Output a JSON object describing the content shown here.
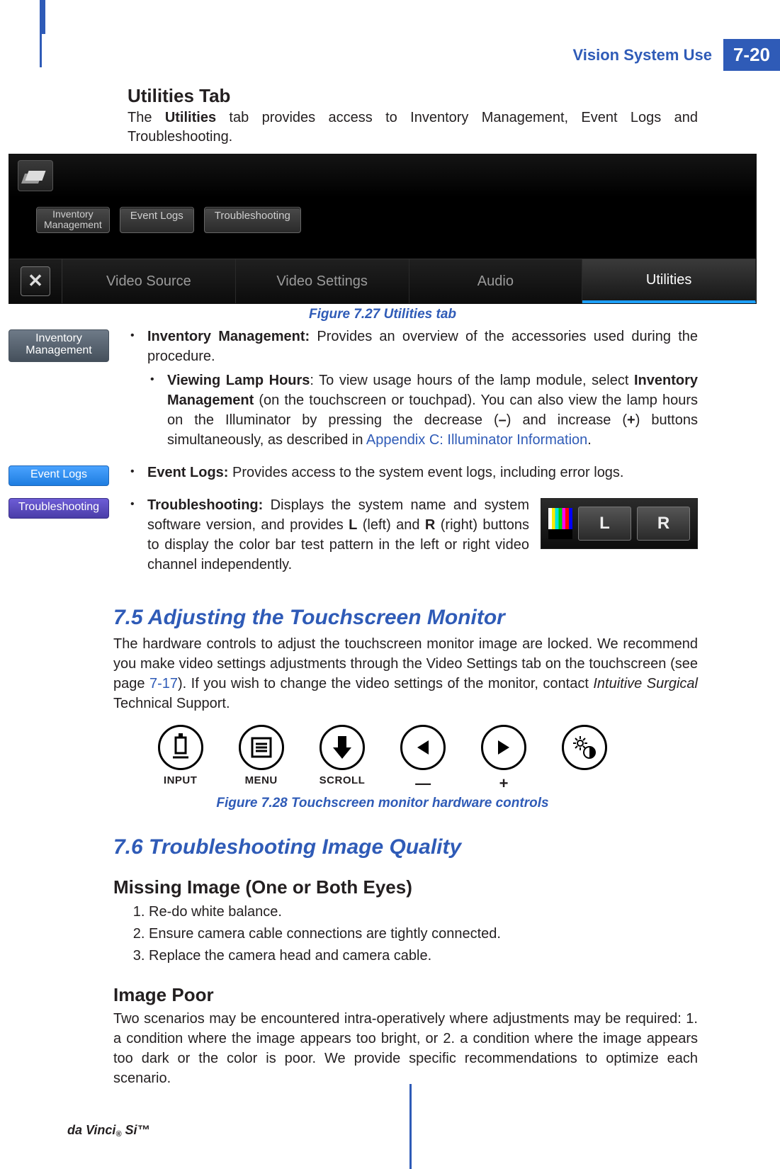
{
  "header": {
    "section_title": "Vision System Use",
    "page_number": "7-20"
  },
  "footer": {
    "product": "da Vinci® Si™"
  },
  "utilities_section": {
    "heading": "Utilities Tab",
    "intro_pre": "The ",
    "intro_bold": "Utilities",
    "intro_post": " tab provides access to Inventory Management, Event Logs and Troubleshooting.",
    "figure_caption": "Figure 7.27 Utilities tab",
    "screenshot": {
      "subtabs": [
        "Inventory\nManagement",
        "Event Logs",
        "Troubleshooting"
      ],
      "close_label": "✕",
      "main_tabs": [
        "Video Source",
        "Video Settings",
        "Audio",
        "Utilities"
      ],
      "active_tab_index": 3
    },
    "side_badges": {
      "inventory": "Inventory\nManagement",
      "eventlogs": "Event Logs",
      "troubleshoot": "Troubleshooting"
    },
    "inventory": {
      "label": "Inventory Management:",
      "text": " Provides an overview of the accessories used during the procedure.",
      "sub_label": "Viewing Lamp Hours",
      "sub_text_1": ": To view usage hours of the lamp module, select ",
      "sub_bold_2": "Inventory Management",
      "sub_text_2": " (on the touchscreen or touchpad). You can also view the lamp hours on the Illuminator by pressing the decrease (",
      "sub_bold_3": "–",
      "sub_text_3": ") and increase (",
      "sub_bold_4": "+",
      "sub_text_4": ") buttons simultaneously, as described in ",
      "sub_link": "Appendix C: Illuminator Information",
      "sub_text_5": "."
    },
    "eventlogs": {
      "label": "Event Logs:",
      "text": " Provides access to the system event logs, including error logs."
    },
    "troubleshoot": {
      "label": "Troubleshooting:",
      "text_pre": " Displays the system name and system software version, and provides ",
      "bold_L": "L",
      "text_mid1": " (left) and ",
      "bold_R": "R",
      "text_mid2": " (right) buttons to display the color bar test pattern in the left or right video channel independently.",
      "lr": {
        "L": "L",
        "R": "R"
      }
    }
  },
  "section_7_5": {
    "heading": "7.5 Adjusting the Touchscreen Monitor",
    "para_pre": "The hardware controls to adjust the touchscreen monitor image are locked. We recommend you make video settings adjustments through the Video Settings tab on the touchscreen (see page ",
    "pageref": "7-17",
    "para_mid": "). If you wish to change the video settings of the monitor, contact ",
    "italic": "Intuitive Surgical",
    "para_post": " Technical Support.",
    "controls": {
      "input": "INPUT",
      "menu": "MENU",
      "scroll": "SCROLL",
      "minus": "—",
      "plus": "+"
    },
    "figure_caption": "Figure 7.28 Touchscreen monitor hardware controls"
  },
  "section_7_6": {
    "heading": "7.6 Troubleshooting Image Quality",
    "missing": {
      "heading": "Missing Image (One or Both Eyes)",
      "steps": [
        "Re-do white balance.",
        "Ensure camera cable connections are tightly connected.",
        "Replace the camera head and camera cable."
      ]
    },
    "imagepoor": {
      "heading": "Image Poor",
      "para": "Two scenarios may be encountered intra-operatively where adjustments may be required: 1. a condition where the image appears too bright, or 2. a condition where the image appears too dark or the color is poor. We provide specific recommendations to optimize each scenario."
    }
  }
}
